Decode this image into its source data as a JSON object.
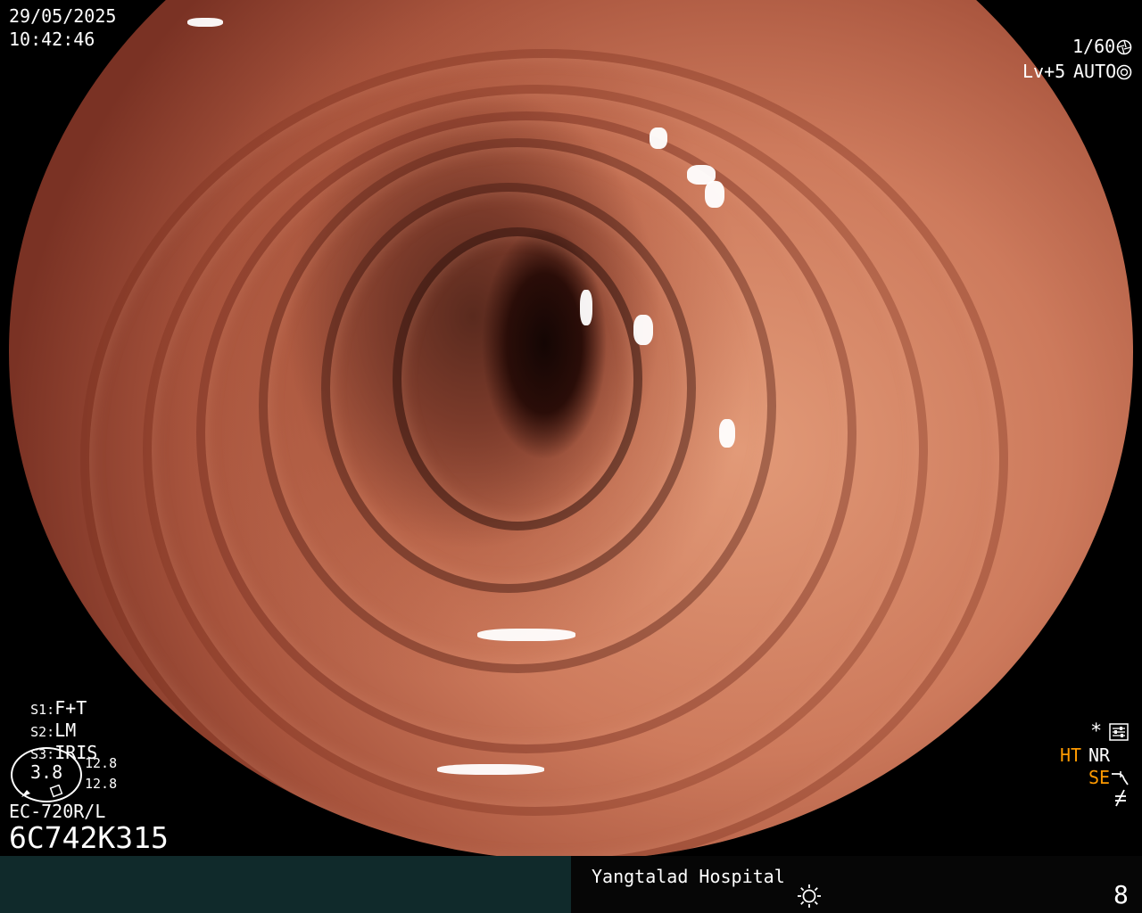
{
  "overlay": {
    "date": "29/05/2025",
    "time": "10:42:46",
    "shutter": "1/60",
    "level": "Lv+5",
    "iris_mode": "AUTO",
    "s1_label": "S1:",
    "s1_value": "F+T",
    "s2_label": "S2:",
    "s2_value": "LM",
    "s3_label": "S3:",
    "s3_value": "IRIS",
    "gauge_value": "3.8",
    "gauge_side_top": "12.8",
    "gauge_side_bottom": "12.8",
    "scope_model": "EC-720R/L",
    "scope_serial": "6C742K315",
    "star": "*",
    "ht": "HT",
    "nr": "NR",
    "se": "SE",
    "hospital": "Yangtalad Hospital",
    "image_number": "8"
  },
  "icons": {
    "shutter": "aperture-icon",
    "iris": "iris-icon",
    "settings": "settings-icon",
    "se_curve": "curve-icon",
    "freeze": "slash-f-icon",
    "brightness": "sun-icon"
  },
  "colors": {
    "highlight_text": "#ff9a00",
    "bottom_bar_left": "#102a2b",
    "bottom_bar_right": "#060606"
  }
}
